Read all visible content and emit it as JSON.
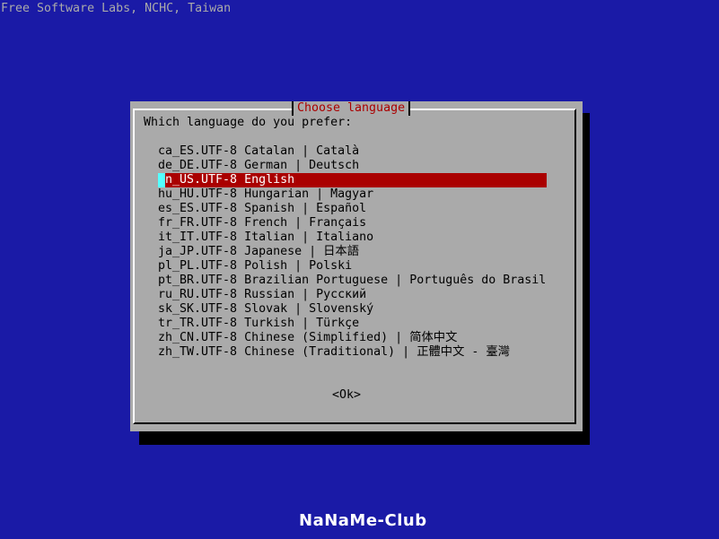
{
  "backtitle": "Free Software Labs, NCHC, Taiwan",
  "dialog": {
    "title": "Choose language",
    "prompt": "Which language do you prefer:",
    "ok_label": "<Ok>",
    "selected_index": 2,
    "items": [
      "ca_ES.UTF-8 Catalan | Català",
      "de_DE.UTF-8 German | Deutsch",
      "en_US.UTF-8 English",
      "hu_HU.UTF-8 Hungarian | Magyar",
      "es_ES.UTF-8 Spanish | Español",
      "fr_FR.UTF-8 French | Français",
      "it_IT.UTF-8 Italian | Italiano",
      "ja_JP.UTF-8 Japanese | 日本語",
      "pl_PL.UTF-8 Polish | Polski",
      "pt_BR.UTF-8 Brazilian Portuguese | Português do Brasil",
      "ru_RU.UTF-8 Russian | Русский",
      "sk_SK.UTF-8 Slovak | Slovenský",
      "tr_TR.UTF-8 Turkish | Türkçe",
      "zh_CN.UTF-8 Chinese (Simplified) | 简体中文",
      "zh_TW.UTF-8 Chinese (Traditional) | 正體中文 - 臺灣"
    ]
  },
  "footer": {
    "logo_text": "NaNaMe-Club"
  },
  "colors": {
    "screen_bg": "#1a1aa6",
    "dialog_bg": "#aaaaaa",
    "title_fg": "#aa0000",
    "selection_bg": "#aa0000",
    "cursor_bg": "#55ffff"
  }
}
